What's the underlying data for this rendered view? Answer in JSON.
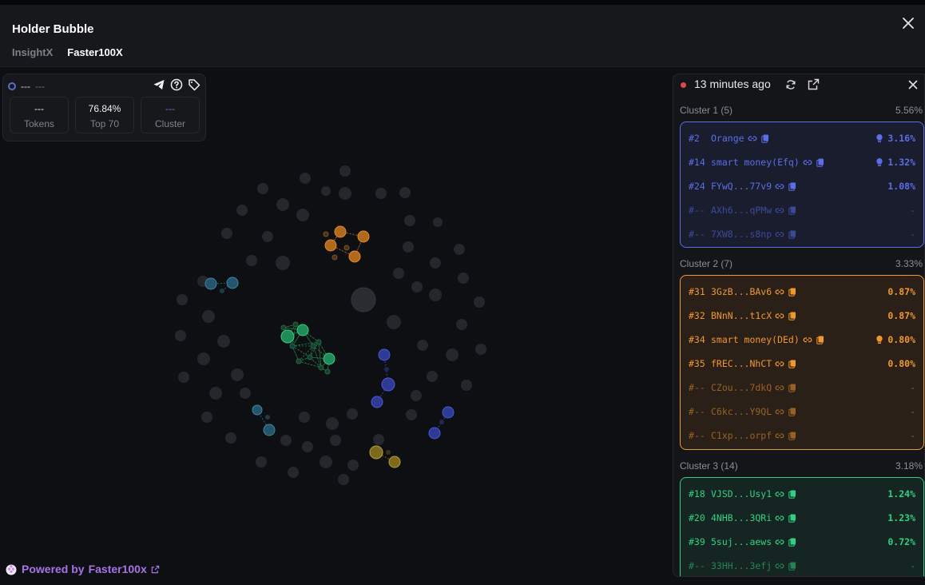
{
  "header": {
    "title": "Holder Bubble",
    "tabs": [
      {
        "label": "InsightX",
        "active": false
      },
      {
        "label": "Faster100X",
        "active": true
      }
    ],
    "close_icon": "close-icon"
  },
  "stats": {
    "token_name": "---",
    "token_symbol": "---",
    "icons": [
      "telegram-icon",
      "help-icon",
      "tag-icon"
    ],
    "boxes": [
      {
        "value": "---",
        "label": "Tokens"
      },
      {
        "value": "76.84%",
        "label": "Top 70"
      },
      {
        "value": "---",
        "label": "Cluster"
      }
    ]
  },
  "footer": {
    "prefix": "Powered by",
    "brand": "Faster100x",
    "brand_color": "#a674e6"
  },
  "panel": {
    "time_ago": "13 minutes ago",
    "live_color": "#e0464c",
    "clusters": [
      {
        "title": "Cluster 1 (5)",
        "pct": "5.56%",
        "color": "#5b6ee8",
        "rows": [
          {
            "rank": "#2",
            "label": "Orange",
            "pct": "3.16%",
            "bulb": true,
            "dim": false
          },
          {
            "rank": "#14",
            "label": "smart money(Efq)",
            "pct": "1.32%",
            "bulb": true,
            "dim": false
          },
          {
            "rank": "#24",
            "label": "FYwQ...77v9",
            "pct": "1.08%",
            "bulb": false,
            "dim": false
          },
          {
            "rank": "#--",
            "label": "AXh6...qPMw",
            "pct": "-",
            "bulb": false,
            "dim": true
          },
          {
            "rank": "#--",
            "label": "7XW8...s8np",
            "pct": "-",
            "bulb": false,
            "dim": true
          }
        ]
      },
      {
        "title": "Cluster 2 (7)",
        "pct": "3.33%",
        "color": "#f0982a",
        "rows": [
          {
            "rank": "#31",
            "label": "3GzB...BAv6",
            "pct": "0.87%",
            "bulb": false,
            "dim": false
          },
          {
            "rank": "#32",
            "label": "BNnN...t1cX",
            "pct": "0.87%",
            "bulb": false,
            "dim": false
          },
          {
            "rank": "#34",
            "label": "smart money(DEd)",
            "pct": "0.80%",
            "bulb": true,
            "dim": false
          },
          {
            "rank": "#35",
            "label": "fREC...NhCT",
            "pct": "0.80%",
            "bulb": false,
            "dim": false
          },
          {
            "rank": "#--",
            "label": "CZou...7dkQ",
            "pct": "-",
            "bulb": false,
            "dim": true
          },
          {
            "rank": "#--",
            "label": "C6kc...Y9QL",
            "pct": "-",
            "bulb": false,
            "dim": true
          },
          {
            "rank": "#--",
            "label": "C1xp...orpf",
            "pct": "-",
            "bulb": false,
            "dim": true
          }
        ]
      },
      {
        "title": "Cluster 3 (14)",
        "pct": "3.18%",
        "color": "#2fd083",
        "rows": [
          {
            "rank": "#18",
            "label": "VJSD...Usy1",
            "pct": "1.24%",
            "bulb": false,
            "dim": false
          },
          {
            "rank": "#20",
            "label": "4NHB...3QRi",
            "pct": "1.23%",
            "bulb": false,
            "dim": false
          },
          {
            "rank": "#39",
            "label": "5suj...aews",
            "pct": "0.72%",
            "bulb": false,
            "dim": false
          },
          {
            "rank": "#--",
            "label": "33HH...3efj",
            "pct": "-",
            "bulb": false,
            "dim": true
          }
        ]
      }
    ]
  }
}
